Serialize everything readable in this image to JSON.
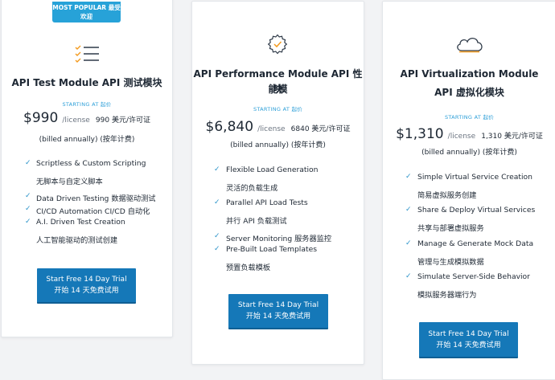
{
  "colors": {
    "accent": "#27a2d8",
    "cta": "#1578b8",
    "check": "#2a93c9",
    "orange": "#f39a1e"
  },
  "plans": [
    {
      "badge": "MOST POPULAR 最受欢迎",
      "icon": "checklist-icon",
      "title_line1": "API Test Module  API 测试模块",
      "title_line2": "",
      "starting": "STARTING AT  起价",
      "price": "$990",
      "license": "/license",
      "price_cn": "990 美元/许可证",
      "billed": "(billed annually)  (按年计费)",
      "features": [
        {
          "en": "Scriptless & Custom Scripting",
          "cn": "无脚本与自定义脚本"
        },
        {
          "en": "Data Driven Testing  数据驱动测试",
          "cn": ""
        },
        {
          "en": "CI/CD Automation  CI/CD 自动化",
          "cn": ""
        },
        {
          "en": "A.I. Driven Test Creation",
          "cn": "人工智能驱动的测试创建"
        }
      ],
      "cta_line1": "Start Free 14 Day Trial",
      "cta_line2": "开始 14 天免费试用"
    },
    {
      "badge": "",
      "icon": "gear-check-icon",
      "title_line1": "API Performance Module  API 性能模",
      "title_line2": "块",
      "starting": "STARTING AT  起价",
      "price": "$6,840",
      "license": "/license",
      "price_cn": "6840 美元/许可证",
      "billed": "(billed annually)  (按年计费)",
      "features": [
        {
          "en": "Flexible Load Generation",
          "cn": "灵活的负载生成"
        },
        {
          "en": "Parallel API Load Tests",
          "cn": "并行 API 负载测试"
        },
        {
          "en": "Server Monitoring  服务器监控",
          "cn": ""
        },
        {
          "en": "Pre-Built Load Templates",
          "cn": "预置负载模板"
        }
      ],
      "cta_line1": "Start Free 14 Day Trial",
      "cta_line2": "开始 14 天免费试用"
    },
    {
      "badge": "",
      "icon": "cloud-icon",
      "title_line1": "API Virtualization Module",
      "title_line2": "API 虚拟化模块",
      "starting": "STARTING AT  起价",
      "price": "$1,310",
      "license": "/license",
      "price_cn": "1,310 美元/许可证",
      "billed": "(billed annually)  (按年计费)",
      "features": [
        {
          "en": "Simple Virtual Service Creation",
          "cn": "简易虚拟服务创建"
        },
        {
          "en": "Share & Deploy Virtual Services",
          "cn": "共享与部署虚拟服务"
        },
        {
          "en": "Manage & Generate Mock Data",
          "cn": "管理与生成模拟数据"
        },
        {
          "en": "Simulate Server-Side Behavior",
          "cn": "模拟服务器端行为"
        }
      ],
      "cta_line1": "Start Free 14 Day Trial",
      "cta_line2": "开始 14 天免费试用"
    }
  ]
}
